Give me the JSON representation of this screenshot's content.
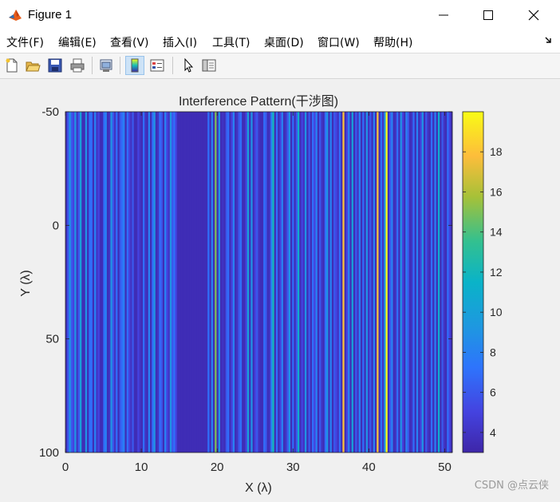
{
  "window": {
    "title": "Figure 1"
  },
  "menu": {
    "items": [
      "文件(F)",
      "编辑(E)",
      "查看(V)",
      "插入(I)",
      "工具(T)",
      "桌面(D)",
      "窗口(W)",
      "帮助(H)"
    ],
    "overflow_icon": "dock-arrow-icon"
  },
  "toolbar": {
    "buttons": [
      {
        "name": "new-figure-icon"
      },
      {
        "name": "open-file-icon"
      },
      {
        "name": "save-icon"
      },
      {
        "name": "print-icon"
      },
      {
        "name": "link-plot-icon"
      },
      {
        "name": "toggle-colorbar-icon",
        "active": true
      },
      {
        "name": "insert-legend-icon"
      },
      {
        "name": "select-pointer-icon"
      },
      {
        "name": "property-editor-icon"
      }
    ]
  },
  "chart_data": {
    "type": "heatmap",
    "title": "Interference Pattern(干涉图)",
    "xlabel": "X (λ)",
    "ylabel": "Y (λ)",
    "xlim": [
      0,
      51
    ],
    "ylim": [
      -50,
      100
    ],
    "y_reversed": true,
    "xticks": [
      0,
      10,
      20,
      30,
      40,
      50
    ],
    "yticks": [
      -50,
      0,
      50,
      100
    ],
    "colormap": "parula",
    "clim": [
      3,
      20
    ],
    "colorbar_ticks": [
      4,
      6,
      8,
      10,
      12,
      14,
      16,
      18
    ],
    "column_values": [
      3.5,
      6,
      9,
      6,
      5,
      9,
      4,
      6,
      10,
      3.5,
      3.5,
      9,
      3.5,
      7,
      7,
      3.5,
      8,
      4,
      5,
      3.5,
      3.5,
      7,
      8,
      3.5,
      4,
      9,
      6,
      4,
      7,
      3.5,
      6,
      7,
      8,
      3.5,
      7,
      5,
      4,
      6,
      3.5,
      3.5,
      5,
      4,
      3.5,
      7,
      4,
      3.5,
      8,
      3.5,
      7,
      9,
      3.5,
      4,
      7,
      6,
      3.5,
      8,
      5,
      4,
      9,
      6,
      7,
      5,
      3.5,
      3.5,
      3.5,
      3.5,
      3.5,
      3.5,
      3.5,
      3.5,
      3.5,
      3.5,
      3.5,
      3.5,
      3.5,
      3.5,
      3.5,
      3.5,
      3.5,
      7,
      3.5,
      8,
      3.5,
      15,
      3.5,
      9,
      3.5,
      4,
      3.5,
      6,
      7,
      3.5,
      5,
      8,
      3.5,
      4,
      6,
      7,
      3.5,
      3.5,
      5,
      10,
      3.5,
      9,
      3.5,
      5,
      6,
      4,
      3.5,
      3.5,
      7,
      6,
      3.5,
      4,
      8,
      12,
      3.5,
      7,
      3.5,
      5,
      8,
      3.5,
      4,
      6,
      9,
      3.5,
      7,
      3.5,
      6,
      11,
      3.5,
      5,
      4,
      9,
      3.5,
      6,
      3.5,
      7,
      5,
      8,
      3.5,
      6,
      4,
      3.5,
      7,
      9,
      3.5,
      8,
      3.5,
      6,
      5,
      4,
      7,
      3.5,
      18,
      3.5,
      5,
      8,
      3.5,
      10,
      3.5,
      6,
      4,
      8,
      3.5,
      7,
      3.5,
      9,
      4,
      6,
      3.5,
      8,
      3.5,
      18,
      3.5,
      7,
      4,
      9,
      20,
      3.5,
      6,
      8,
      3.5,
      4,
      7,
      3.5,
      9,
      5,
      3.5,
      8,
      6,
      3.5,
      4,
      7,
      3.5,
      8,
      3.5,
      5,
      9,
      3.5,
      6,
      4,
      3.5,
      7,
      3.5,
      8,
      3.5,
      11,
      3.5,
      6,
      4,
      3.5,
      7,
      5,
      3.5
    ]
  },
  "watermark": "CSDN @点云侠"
}
